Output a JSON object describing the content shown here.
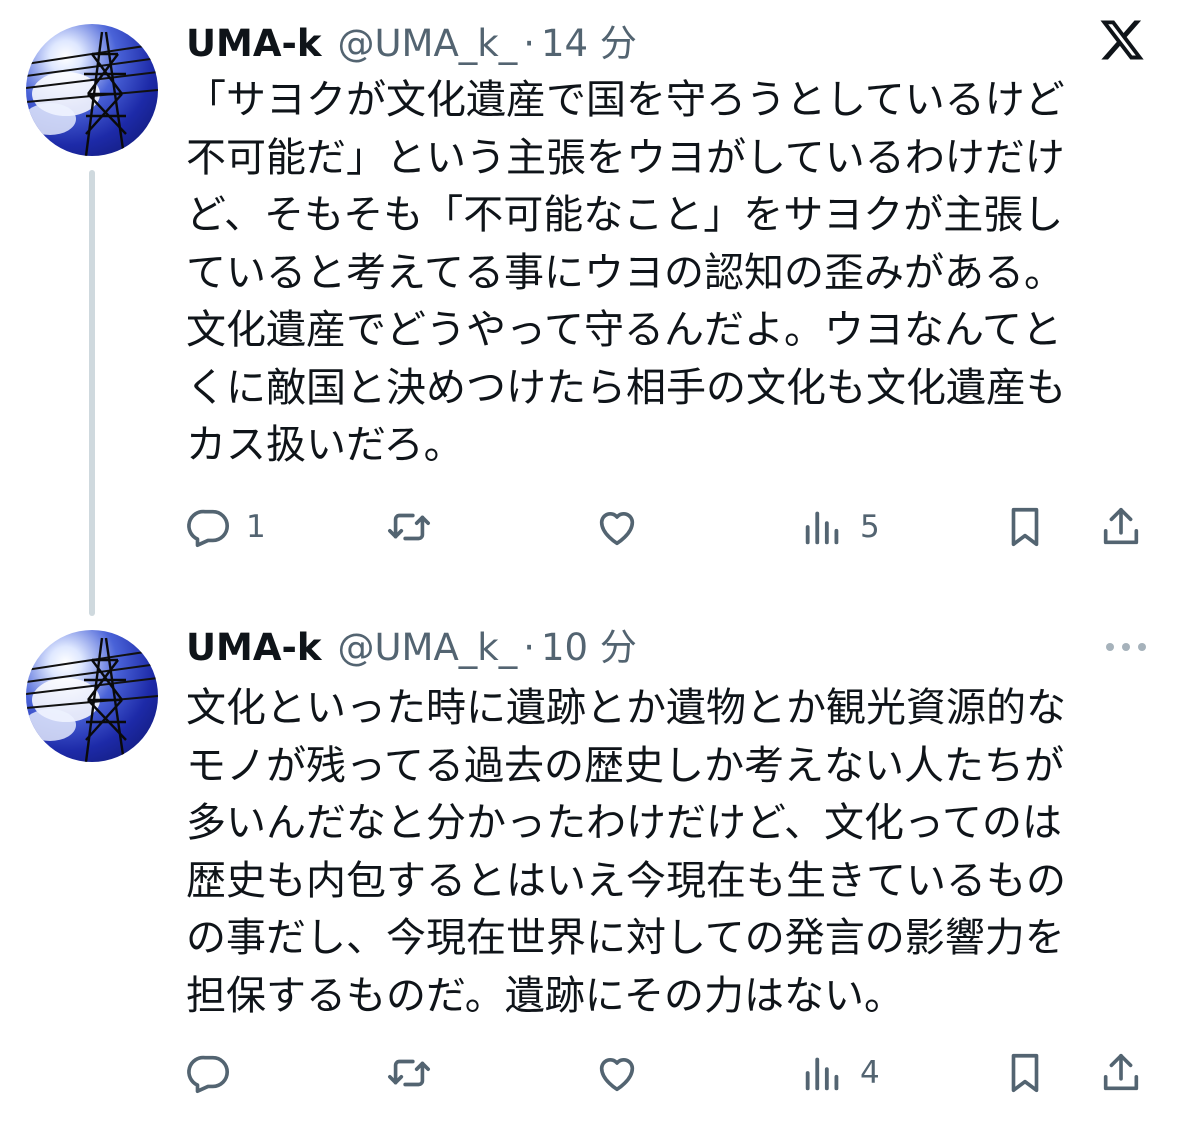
{
  "tweets": [
    {
      "display_name": "UMA-k",
      "handle": "@UMA_k_",
      "separator": "·",
      "time": "14 分",
      "text": "「サヨクが文化遺産で国を守ろうとしているけど\n不可能だ」という主張をウヨがしているわけだけ\nど、そもそも「不可能なこと」をサヨクが主張し\nていると考えてる事にウヨの認知の歪みがある。\n文化遺産でどうやって守るんだよ。ウヨなんてと\nくに敵国と決めつけたら相手の文化も文化遺産も\nカス扱いだろ。",
      "replies": "1",
      "retweets": "",
      "likes": "",
      "views": "5",
      "corner_icon": "x-logo-icon"
    },
    {
      "display_name": "UMA-k",
      "handle": "@UMA_k_",
      "separator": "·",
      "time": "10 分",
      "text": "文化といった時に遺跡とか遺物とか観光資源的な\nモノが残ってる過去の歴史しか考えない人たちが\n多いんだなと分かったわけだけど、文化ってのは\n歴史も内包するとはいえ今現在も生きているもの\nの事だし、今現在世界に対しての発言の影響力を\n担保するものだ。遺跡にその力はない。",
      "replies": "",
      "retweets": "",
      "likes": "",
      "views": "4",
      "corner_icon": "more-dots-icon"
    }
  ],
  "colors": {
    "text_primary": "#0f1419",
    "text_secondary": "#536471",
    "thread_line": "#cfd9de",
    "background": "#ffffff"
  },
  "icons": [
    "reply-icon",
    "retweet-icon",
    "like-icon",
    "views-icon",
    "bookmark-icon",
    "share-icon"
  ]
}
